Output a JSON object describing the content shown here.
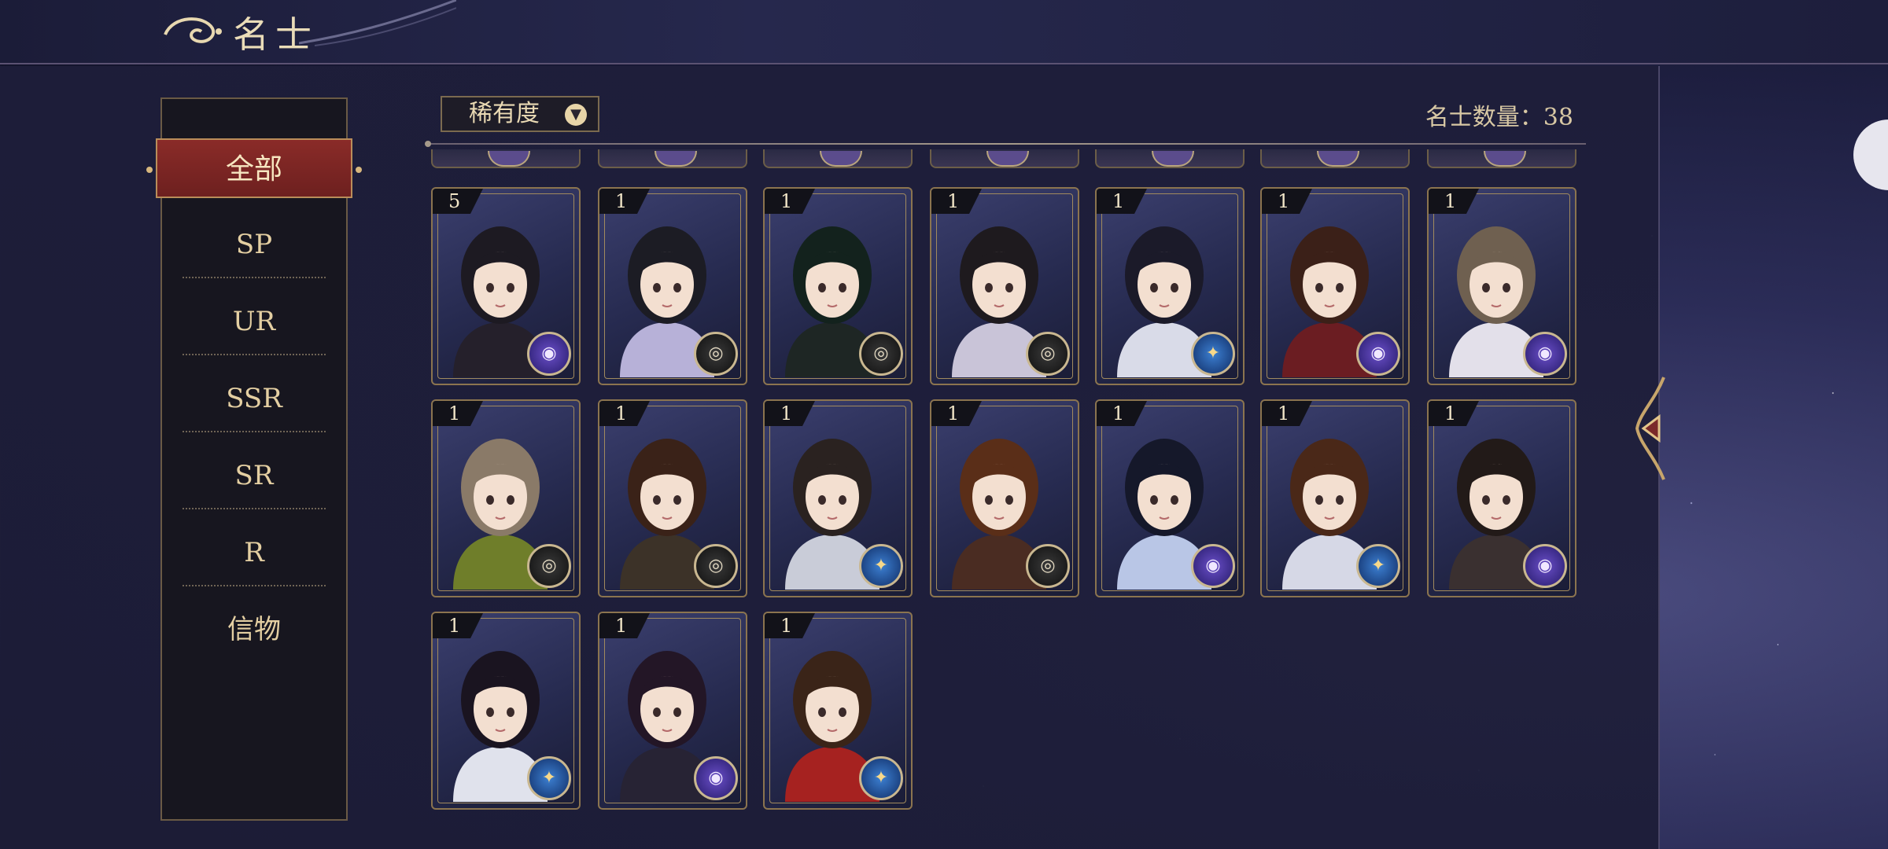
{
  "header": {
    "title": "名士"
  },
  "filter": {
    "label": "稀有度"
  },
  "count": {
    "text": "名士数量：38"
  },
  "sidebar": {
    "items": [
      {
        "label": "全部",
        "active": true
      },
      {
        "label": "SP"
      },
      {
        "label": "UR"
      },
      {
        "label": "SSR"
      },
      {
        "label": "SR"
      },
      {
        "label": "R"
      },
      {
        "label": "信物"
      }
    ]
  },
  "cards": [
    {
      "level": "5",
      "badge": "purple",
      "hair": "#1d1a22",
      "robe": "#25202b"
    },
    {
      "level": "1",
      "badge": "dark",
      "hair": "#1c1c24",
      "robe": "#b7b1d8"
    },
    {
      "level": "1",
      "badge": "dark",
      "hair": "#13221d",
      "robe": "#1e2624"
    },
    {
      "level": "1",
      "badge": "dark",
      "hair": "#1e1a1e",
      "robe": "#c9c4d8"
    },
    {
      "level": "1",
      "badge": "blue",
      "hair": "#1b1a29",
      "robe": "#d9dbe8"
    },
    {
      "level": "1",
      "badge": "purple",
      "hair": "#3b2018",
      "robe": "#6b1d22"
    },
    {
      "level": "1",
      "badge": "purple",
      "hair": "#6f6050",
      "robe": "#e3e0ea"
    },
    {
      "level": "1",
      "badge": "dark",
      "hair": "#8a7a68",
      "robe": "#6f7e2a"
    },
    {
      "level": "1",
      "badge": "dark",
      "hair": "#3a2218",
      "robe": "#3c3228"
    },
    {
      "level": "1",
      "badge": "blue",
      "hair": "#2a2220",
      "robe": "#c9ccd8"
    },
    {
      "level": "1",
      "badge": "dark",
      "hair": "#5a2e18",
      "robe": "#4a2c22"
    },
    {
      "level": "1",
      "badge": "purple",
      "hair": "#15182a",
      "robe": "#b9c6e6"
    },
    {
      "level": "1",
      "badge": "blue",
      "hair": "#4a2818",
      "robe": "#d6d8e6"
    },
    {
      "level": "1",
      "badge": "purple",
      "hair": "#221a18",
      "robe": "#3a3030"
    },
    {
      "level": "1",
      "badge": "blue",
      "hair": "#1a1420",
      "robe": "#e0e2ec"
    },
    {
      "level": "1",
      "badge": "purple",
      "hair": "#231626",
      "robe": "#272334"
    },
    {
      "level": "1",
      "badge": "blue",
      "hair": "#3a2418",
      "robe": "#a62220"
    }
  ]
}
